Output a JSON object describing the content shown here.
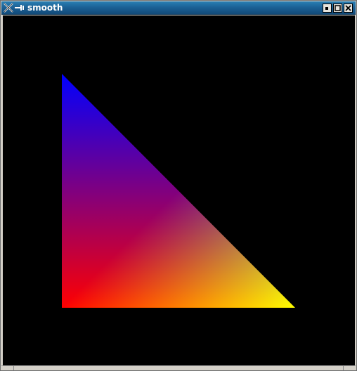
{
  "window": {
    "title": "smooth",
    "buttons": [
      "minimize",
      "maximize",
      "close"
    ]
  },
  "titlebar": {
    "app_icon": "x-window-icon",
    "menu_icon": "window-menu-icon",
    "colors": {
      "gradient_top": "#2a7fb4",
      "gradient_bottom": "#124a78",
      "title_text": "#ffffff"
    }
  },
  "canvas": {
    "background": "#000000",
    "shape": "triangle",
    "vertices": [
      {
        "name": "top",
        "color": "#0000ff"
      },
      {
        "name": "bottom-left",
        "color": "#ff0000"
      },
      {
        "name": "bottom-right",
        "color": "#00ff00"
      }
    ]
  }
}
